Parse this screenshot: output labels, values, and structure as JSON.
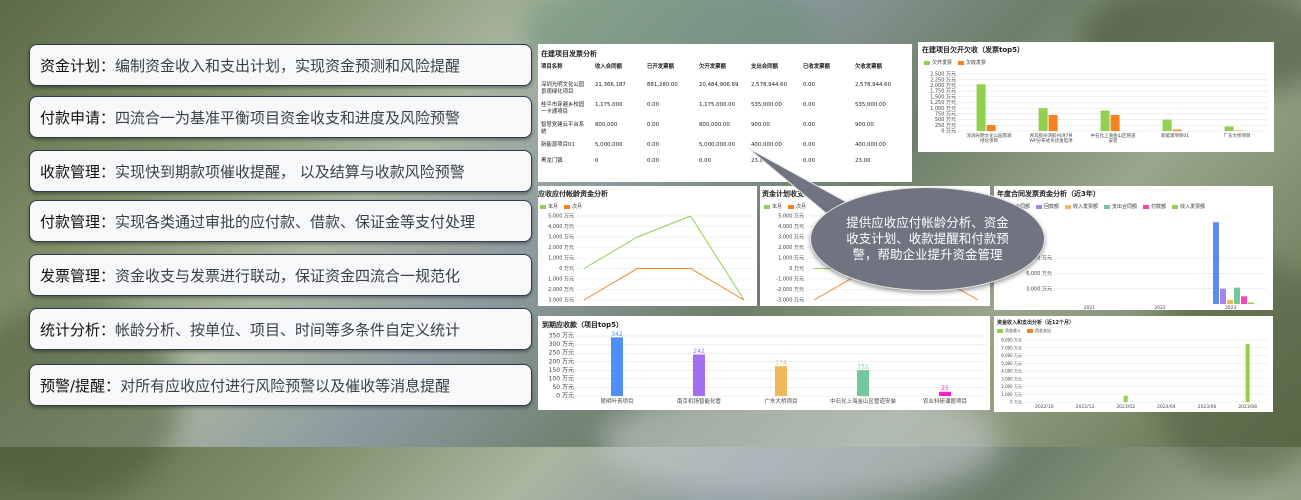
{
  "features": [
    {
      "key": "资金计划",
      "sep": "：",
      "desc": "编制资金收入和支出计划，实现资金预测和风险提醒"
    },
    {
      "key": "付款申请",
      "sep": "：",
      "desc": "四流合一为基准平衡项目资金收支和进度及风险预警"
    },
    {
      "key": "收款管理",
      "sep": "：",
      "desc": "实现快到期款项催收提醒， 以及结算与收款风险预警"
    },
    {
      "key": "付款管理",
      "sep": "：",
      "desc": "实现各类通过审批的应付款、借款、保证金等支付处理"
    },
    {
      "key": "发票管理",
      "sep": "：",
      "desc": "资金收支与发票进行联动，保证资金四流合一规范化"
    },
    {
      "key": "统计分析",
      "sep": "：",
      "desc": "帐龄分析、按单位、项目、时间等多条件自定义统计"
    },
    {
      "key": "预警/提醒",
      "sep": "：",
      "desc": "对所有应收应付进行风险预警以及催收等消息提醒"
    }
  ],
  "callout": "提供应收应付帐龄分析、资金收支计划、收款提醒和付款预警，帮助企业提升资金管理",
  "invoice_table": {
    "title": "在建项目发票分析",
    "headers": [
      "项目名称",
      "收入合同额",
      "已开发票额",
      "欠开发票额",
      "支出合同额",
      "已收发票额",
      "欠收发票额"
    ],
    "rows": [
      [
        "深圳光明文化公园景观绿化项目",
        "21,366,187",
        "881,280.00",
        "20,484,906.69",
        "2,578,944.60",
        "0.00",
        "2,578,944.60"
      ],
      [
        "桂平市穿越乡校园一卡通项目",
        "1,175,000",
        "0.00",
        "1,175,000.00",
        "535,000.00",
        "0.00",
        "535,000.00"
      ],
      [
        "智慧党建云平台系统",
        "800,000",
        "0.00",
        "800,000.00",
        "900.00",
        "0.00",
        "900.00"
      ],
      [
        "新能源项目01",
        "5,000,000",
        "0.00",
        "5,000,000.00",
        "400,000.00",
        "0.00",
        "400,000.00"
      ],
      [
        "黑龙门镇",
        "0",
        "0.00",
        "0.00",
        "23.00",
        "0.00",
        "23.00"
      ]
    ]
  },
  "chart_data": [
    {
      "type": "bar",
      "title": "在建项目欠开欠收（发票top5）",
      "categories": [
        "深圳光明文化公园景观绿化项目",
        "青岛胶州湾胶州湾7MWP分布式光伏发电项目",
        "中石化上海金山区管道安装",
        "新能源项目01",
        "广东大桥项目"
      ],
      "series": [
        {
          "name": "欠开发票",
          "color": "#92d050",
          "values": [
            2050,
            1000,
            900,
            500,
            200
          ]
        },
        {
          "name": "欠收发票",
          "color": "#f5821f",
          "values": [
            260,
            700,
            700,
            60,
            20
          ]
        }
      ],
      "yticks": [
        "0 万元",
        "250 万元",
        "500 万元",
        "750 万元",
        "1,000 万元",
        "1,250 万元",
        "1,500 万元",
        "1,750 万元",
        "2,000 万元",
        "2,250 万元",
        "2,500 万元"
      ],
      "ylim": [
        0,
        2500
      ]
    },
    {
      "type": "line",
      "title": "应收应付帐龄资金分析",
      "series": [
        {
          "name": "本月",
          "color": "#92d050",
          "values": [
            0,
            3000,
            5000,
            -3000
          ]
        },
        {
          "name": "次月",
          "color": "#f5821f",
          "values": [
            -3000,
            0,
            0,
            -3000
          ]
        }
      ],
      "yticks": [
        "3,000 万元",
        "2,000 万元",
        "1,000 万元",
        "0 万元",
        "1,000 万元",
        "2,000 万元",
        "3,000 万元",
        "4,000 万元",
        "5,000 万元"
      ],
      "ylim": [
        -3000,
        5000
      ]
    },
    {
      "type": "line",
      "title": "资金计划收支动",
      "series": [
        {
          "name": "本月",
          "color": "#92d050",
          "values": [
            0,
            0,
            0,
            0
          ]
        },
        {
          "name": "次月",
          "color": "#f5821f",
          "values": [
            -3000,
            0,
            0,
            -3000
          ]
        }
      ],
      "yticks": [
        "-3,000 万元",
        "-2,000 万元",
        "-1,000 万元",
        "0 万元",
        "1,000 万元",
        "2,000 万元",
        "3,000 万元",
        "4,000 万元",
        "5,000 万元"
      ],
      "ylim": [
        -3000,
        5000
      ]
    },
    {
      "type": "bar",
      "title": "年度合同发票资金分析（近3年）",
      "categories": [
        "2021",
        "2022",
        "2023"
      ],
      "series": [
        {
          "name": "收入合同额",
          "color": "#5b8def",
          "values": [
            0,
            0,
            16000
          ]
        },
        {
          "name": "回款额",
          "color": "#a983e8",
          "values": [
            0,
            0,
            3000
          ]
        },
        {
          "name": "收入发票额",
          "color": "#f2b65b",
          "values": [
            0,
            0,
            800
          ]
        },
        {
          "name": "支出合同额",
          "color": "#74c69d",
          "values": [
            0,
            0,
            3200
          ]
        },
        {
          "name": "付款额",
          "color": "#ff3fb4",
          "values": [
            0,
            0,
            1500
          ]
        },
        {
          "name": "收入发票额",
          "color": "#92d050",
          "values": [
            0,
            0,
            300
          ]
        }
      ],
      "yticks": [
        "3,000 万元",
        "6,000 万元",
        "9,000 万元"
      ],
      "ylim": [
        0,
        18000
      ]
    },
    {
      "type": "bar",
      "title": "到期应收款（项目top5）",
      "categories": [
        "昆明叶青项目",
        "南京机场智能化管",
        "广东大桥项目",
        "中石化上海金山区管道安装",
        "农业科研课题项目"
      ],
      "values": [
        342,
        242,
        174,
        151,
        25
      ],
      "colors": [
        "#4f8ef7",
        "#a070f0",
        "#f2b65b",
        "#74c69d",
        "#ff22c8"
      ],
      "yticks": [
        "0 万元",
        "50 万元",
        "100 万元",
        "150 万元",
        "200 万元",
        "250 万元",
        "300 万元",
        "350 万元"
      ],
      "ylim": [
        0,
        350
      ]
    },
    {
      "type": "bar",
      "title": "资金收入和支出分析（近12个月）",
      "categories": [
        "2022/10",
        "2022/12",
        "2023/02",
        "2023/04",
        "2023/06",
        "2023/08"
      ],
      "series": [
        {
          "name": "资金收入",
          "color": "#92d050",
          "values": [
            0,
            0,
            800,
            0,
            0,
            7500
          ]
        },
        {
          "name": "资金支出",
          "color": "#f5821f",
          "values": [
            0,
            0,
            0,
            0,
            0,
            0
          ]
        }
      ],
      "yticks": [
        "0 万元",
        "1,000 万元",
        "2,000 万元",
        "3,000 万元",
        "4,000 万元",
        "5,000 万元",
        "6,000 万元",
        "7,000 万元",
        "8,000 万元"
      ],
      "ylim": [
        0,
        8000
      ]
    }
  ]
}
